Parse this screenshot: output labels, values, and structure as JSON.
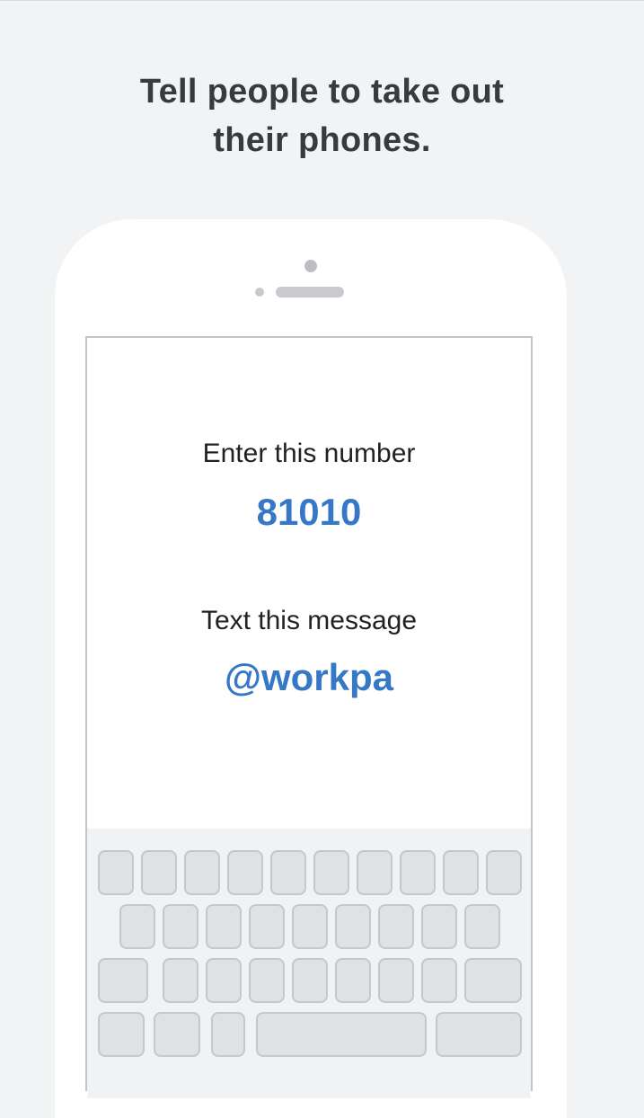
{
  "headline": {
    "line1": "Tell people to take out",
    "line2": "their phones."
  },
  "phone_screen": {
    "number_label": "Enter this number",
    "number_value": "81010",
    "message_label": "Text this message",
    "message_value": "@workpa"
  },
  "colors": {
    "background": "#f2f3f5",
    "headline_text": "#373a3f",
    "accent_blue": "#3678c5",
    "key_fill": "#e0e1e3",
    "key_border": "#c6c7ca"
  }
}
